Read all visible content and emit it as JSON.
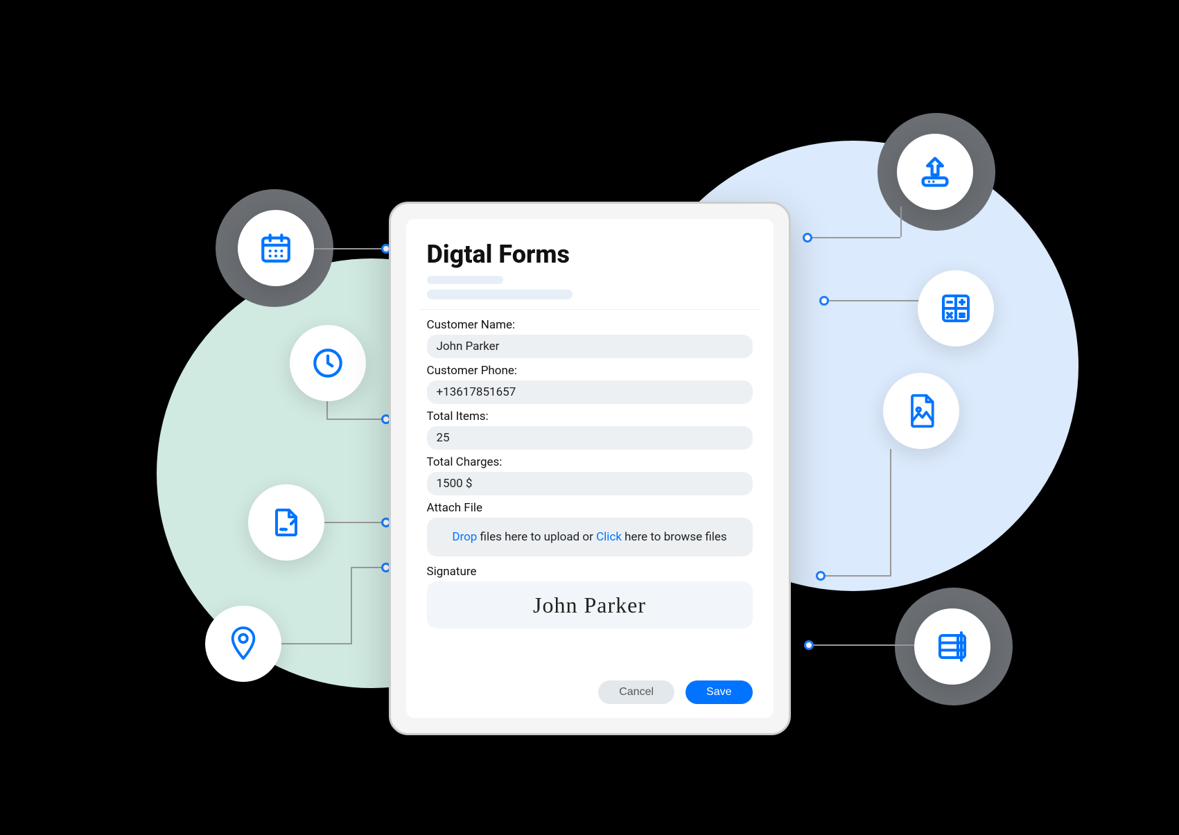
{
  "form": {
    "title": "Digtal Forms",
    "fields": {
      "customer_name": {
        "label": "Customer Name:",
        "value": "John Parker"
      },
      "customer_phone": {
        "label": "Customer Phone:",
        "value": "+13617851657"
      },
      "total_items": {
        "label": "Total Items:",
        "value": "25"
      },
      "total_charges": {
        "label": "Total Charges:",
        "value": "1500 $"
      },
      "attach_file": {
        "label": "Attach File"
      },
      "signature": {
        "label": "Signature",
        "value": "John Parker"
      }
    },
    "dropzone": {
      "word_drop": "Drop",
      "text_mid": " files here to upload or ",
      "word_click": "Click",
      "text_end": " here to browse files"
    },
    "buttons": {
      "cancel": "Cancel",
      "save": "Save"
    }
  },
  "icons": {
    "calendar": "calendar",
    "clock": "clock",
    "document": "document-sign",
    "pin": "location-pin",
    "upload": "upload",
    "calculator": "calculator",
    "image": "image-file",
    "table": "table"
  },
  "colors": {
    "accent": "#0074ff",
    "blob_left": "#d0e9e1",
    "blob_right": "#dbeafc",
    "gray_ring": "#6a6e73",
    "field_bg": "#edf0f3"
  }
}
